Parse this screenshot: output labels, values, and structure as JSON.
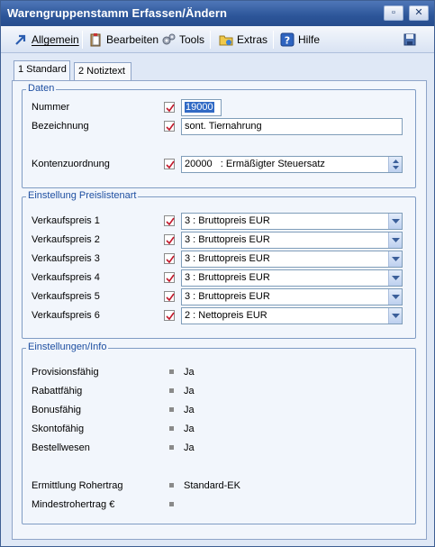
{
  "window": {
    "title": "Warengruppenstamm Erfassen/Ändern"
  },
  "menubar": {
    "items": [
      {
        "label": "Allgemein"
      },
      {
        "label": "Bearbeiten"
      },
      {
        "label": "Tools"
      },
      {
        "label": "Extras"
      },
      {
        "label": "Hilfe"
      }
    ]
  },
  "tabs": [
    {
      "label": "1 Standard"
    },
    {
      "label": "2 Notiztext"
    }
  ],
  "daten": {
    "title": "Daten",
    "nummer_label": "Nummer",
    "nummer_value": "19000",
    "bezeichnung_label": "Bezeichnung",
    "bezeichnung_value": "sont. Tiernahrung",
    "konten_label": "Kontenzuordnung",
    "konten_value": "20000   : Ermäßigter Steuersatz"
  },
  "preisliste": {
    "title": "Einstellung Preislistenart",
    "rows": [
      {
        "label": "Verkaufspreis 1",
        "value": "3 : Bruttopreis EUR"
      },
      {
        "label": "Verkaufspreis 2",
        "value": "3 : Bruttopreis EUR"
      },
      {
        "label": "Verkaufspreis 3",
        "value": "3 : Bruttopreis EUR"
      },
      {
        "label": "Verkaufspreis 4",
        "value": "3 : Bruttopreis EUR"
      },
      {
        "label": "Verkaufspreis 5",
        "value": "3 : Bruttopreis EUR"
      },
      {
        "label": "Verkaufspreis 6",
        "value": "2 : Nettopreis EUR"
      }
    ]
  },
  "info": {
    "title": "Einstellungen/Info",
    "rows": [
      {
        "label": "Provisionsfähig",
        "value": "Ja"
      },
      {
        "label": "Rabattfähig",
        "value": "Ja"
      },
      {
        "label": "Bonusfähig",
        "value": "Ja"
      },
      {
        "label": "Skontofähig",
        "value": "Ja"
      },
      {
        "label": "Bestellwesen",
        "value": "Ja"
      },
      {
        "label": "Ermittlung Rohertrag",
        "value": "Standard-EK"
      },
      {
        "label": "Mindestrohertrag €",
        "value": ""
      }
    ]
  }
}
